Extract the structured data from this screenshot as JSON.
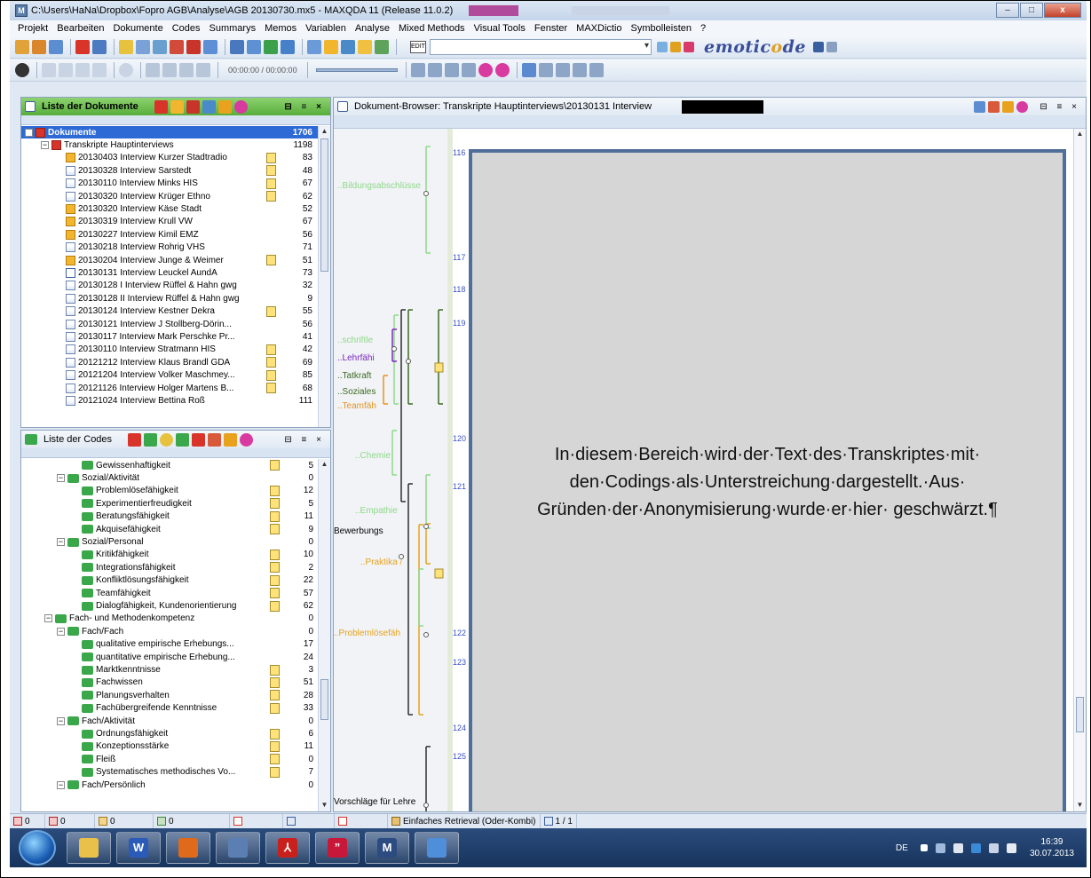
{
  "window": {
    "title": "C:\\Users\\HaNa\\Dropbox\\Fopro AGB\\Analyse\\AGB 20130730.mx5 - MAXQDA 11  (Release 11.0.2)",
    "min": "–",
    "max": "□",
    "close": "x"
  },
  "menu": [
    "Projekt",
    "Bearbeiten",
    "Dokumente",
    "Codes",
    "Summarys",
    "Memos",
    "Variablen",
    "Analyse",
    "Mixed Methods",
    "Visual Tools",
    "Fenster",
    "MAXDictio",
    "Symbolleisten",
    "?"
  ],
  "toolbar": {
    "edit_label": "EDIT",
    "emoticode_pre": "emotic",
    "emoticode_o": "o",
    "emoticode_post": "de",
    "timecode": "00:00:00 / 00:00:00"
  },
  "documents": {
    "title": "Liste der Dokumente",
    "root": {
      "label": "Dokumente",
      "count": "1706"
    },
    "group": {
      "label": "Transkripte Hauptinterviews",
      "count": "1198"
    },
    "items": [
      {
        "label": "20130403 Interview Kurzer Stadtradio",
        "count": "83",
        "icon": "aud",
        "memo": true
      },
      {
        "label": "20130328 Interview Sarstedt",
        "count": "48",
        "icon": "doc",
        "memo": true
      },
      {
        "label": "20130110 Interview Minks HIS",
        "count": "67",
        "icon": "doc",
        "memo": true
      },
      {
        "label": "20130320 Interview Krüger Ethno",
        "count": "62",
        "icon": "doc",
        "memo": true
      },
      {
        "label": "20130320 Interview Käse Stadt",
        "count": "52",
        "icon": "aud",
        "memo": false
      },
      {
        "label": "20130319 Interview Krull VW",
        "count": "67",
        "icon": "aud",
        "memo": false
      },
      {
        "label": "20130227 Interview Kimil EMZ",
        "count": "56",
        "icon": "aud",
        "memo": false
      },
      {
        "label": "20130218 Interview Rohrig VHS",
        "count": "71",
        "icon": "doc",
        "memo": false
      },
      {
        "label": "20130204 Interview Junge & Weimer",
        "count": "51",
        "icon": "aud",
        "memo": true
      },
      {
        "label": "20130131 Interview Leuckel AundA",
        "count": "73",
        "icon": "edit",
        "memo": false
      },
      {
        "label": "20130128 I Interview Rüffel & Hahn gwg",
        "count": "32",
        "icon": "doc",
        "memo": false
      },
      {
        "label": "20130128 II Interview Rüffel & Hahn gwg",
        "count": "9",
        "icon": "doc",
        "memo": false
      },
      {
        "label": "20130124 Interview Kestner Dekra",
        "count": "55",
        "icon": "doc",
        "memo": true
      },
      {
        "label": "20130121 Interview J Stollberg-Dörin...",
        "count": "56",
        "icon": "doc",
        "memo": false
      },
      {
        "label": "20130117 Interview Mark Perschke Pr...",
        "count": "41",
        "icon": "doc",
        "memo": false
      },
      {
        "label": "20130110 Interview Stratmann HIS",
        "count": "42",
        "icon": "doc",
        "memo": true
      },
      {
        "label": "20121212 Interview Klaus Brandl GDA",
        "count": "69",
        "icon": "doc",
        "memo": true
      },
      {
        "label": "20121204 Interview Volker Maschmey...",
        "count": "85",
        "icon": "doc",
        "memo": true
      },
      {
        "label": "20121126 Interview Holger Martens B...",
        "count": "68",
        "icon": "doc",
        "memo": true
      },
      {
        "label": "20121024 Interview Bettina Roß",
        "count": "111",
        "icon": "doc",
        "memo": false
      }
    ]
  },
  "codes": {
    "title": "Liste der Codes",
    "items": [
      {
        "label": "Gewissenhaftigkeit",
        "count": "5",
        "level": 3,
        "memo": true
      },
      {
        "label": "Sozial/Aktivität",
        "count": "0",
        "level": 2,
        "memo": false,
        "toggle": "−"
      },
      {
        "label": "Problemlösefähigkeit",
        "count": "12",
        "level": 3,
        "memo": true
      },
      {
        "label": "Experimentierfreudigkeit",
        "count": "5",
        "level": 3,
        "memo": true
      },
      {
        "label": "Beratungsfähigkeit",
        "count": "11",
        "level": 3,
        "memo": true
      },
      {
        "label": "Akquisefähigkeit",
        "count": "9",
        "level": 3,
        "memo": true
      },
      {
        "label": "Sozial/Personal",
        "count": "0",
        "level": 2,
        "memo": false,
        "toggle": "−"
      },
      {
        "label": "Kritikfähigkeit",
        "count": "10",
        "level": 3,
        "memo": true
      },
      {
        "label": "Integrationsfähigkeit",
        "count": "2",
        "level": 3,
        "memo": true
      },
      {
        "label": "Konfliktlösungsfähigkeit",
        "count": "22",
        "level": 3,
        "memo": true
      },
      {
        "label": "Teamfähigkeit",
        "count": "57",
        "level": 3,
        "memo": true
      },
      {
        "label": "Dialogfähigkeit, Kundenorientierung",
        "count": "62",
        "level": 3,
        "memo": true
      },
      {
        "label": "Fach- und Methodenkompetenz",
        "count": "0",
        "level": 1,
        "memo": false,
        "toggle": "−"
      },
      {
        "label": "Fach/Fach",
        "count": "0",
        "level": 2,
        "memo": false,
        "toggle": "−"
      },
      {
        "label": "qualitative empirische Erhebungs...",
        "count": "17",
        "level": 3,
        "memo": false
      },
      {
        "label": "quantitative empirische Erhebung...",
        "count": "24",
        "level": 3,
        "memo": false
      },
      {
        "label": "Marktkenntnisse",
        "count": "3",
        "level": 3,
        "memo": true
      },
      {
        "label": "Fachwissen",
        "count": "51",
        "level": 3,
        "memo": true
      },
      {
        "label": "Planungsverhalten",
        "count": "28",
        "level": 3,
        "memo": true
      },
      {
        "label": "Fachübergreifende Kenntnisse",
        "count": "33",
        "level": 3,
        "memo": true
      },
      {
        "label": "Fach/Aktivität",
        "count": "0",
        "level": 2,
        "memo": false,
        "toggle": "−"
      },
      {
        "label": "Ordnungsfähigkeit",
        "count": "6",
        "level": 3,
        "memo": true
      },
      {
        "label": "Konzeptionsstärke",
        "count": "11",
        "level": 3,
        "memo": true
      },
      {
        "label": "Fleiß",
        "count": "0",
        "level": 3,
        "memo": true
      },
      {
        "label": "Systematisches methodisches Vo...",
        "count": "7",
        "level": 3,
        "memo": true
      },
      {
        "label": "Fach/Persönlich",
        "count": "0",
        "level": 2,
        "memo": false,
        "toggle": "−"
      }
    ]
  },
  "browser": {
    "title": "Dokument-Browser: Transkripte Hauptinterviews\\20130131 Interview",
    "line_numbers": [
      "116",
      "117",
      "118",
      "119",
      "120",
      "121",
      "122",
      "123",
      "124",
      "125"
    ],
    "code_labels": [
      {
        "text": "..Bildungsabschlüsse",
        "color": "#8fd88a"
      },
      {
        "text": "..schriftle",
        "color": "#8fd88a"
      },
      {
        "text": "..Lehrfähi",
        "color": "#7a28c0"
      },
      {
        "text": "..Tatkraft",
        "color": "#3d6b22"
      },
      {
        "text": "..Soziales",
        "color": "#3d6b22"
      },
      {
        "text": "..Teamfäh",
        "color": "#e8941e"
      },
      {
        "text": "..Chemie",
        "color": "#8fd88a"
      },
      {
        "text": "..Empathie",
        "color": "#8fd88a"
      },
      {
        "text": "Bewerbungs",
        "color": "#000000"
      },
      {
        "text": "..Praktika /",
        "color": "#e8a21e"
      },
      {
        "text": "..Problemlösefäh",
        "color": "#e8a21e"
      },
      {
        "text": "Vorschläge für Lehre",
        "color": "#000000"
      }
    ],
    "overlay_text": "In·diesem·Bereich·wird·der·Text·des·Transkriptes·mit· den·Codings·als·Unterstreichung·dargestellt.·Aus· Gründen·der·Anonymisierung·wurde·er·hier· geschwärzt.¶"
  },
  "statusbar": {
    "counts": [
      "0",
      "0",
      "0",
      "0"
    ],
    "retrieval": "Einfaches Retrieval (Oder-Kombi)",
    "page": "1 / 1"
  },
  "taskbar": {
    "lang": "DE",
    "time": "16:39",
    "date": "30.07.2013",
    "apps": [
      {
        "name": "explorer",
        "color": "#e8c04a",
        "glyph": ""
      },
      {
        "name": "word",
        "color": "#2a5bb8",
        "glyph": "W"
      },
      {
        "name": "firefox",
        "color": "#e06a1c",
        "glyph": ""
      },
      {
        "name": "thunderbird",
        "color": "#5b7fb3",
        "glyph": ""
      },
      {
        "name": "acrobat",
        "color": "#c8201c",
        "glyph": "⅄"
      },
      {
        "name": "citavi",
        "color": "#c8183a",
        "glyph": "”"
      },
      {
        "name": "maxqda",
        "color": "#2c4b80",
        "glyph": "M"
      },
      {
        "name": "network",
        "color": "#4f8ed8",
        "glyph": ""
      }
    ]
  }
}
